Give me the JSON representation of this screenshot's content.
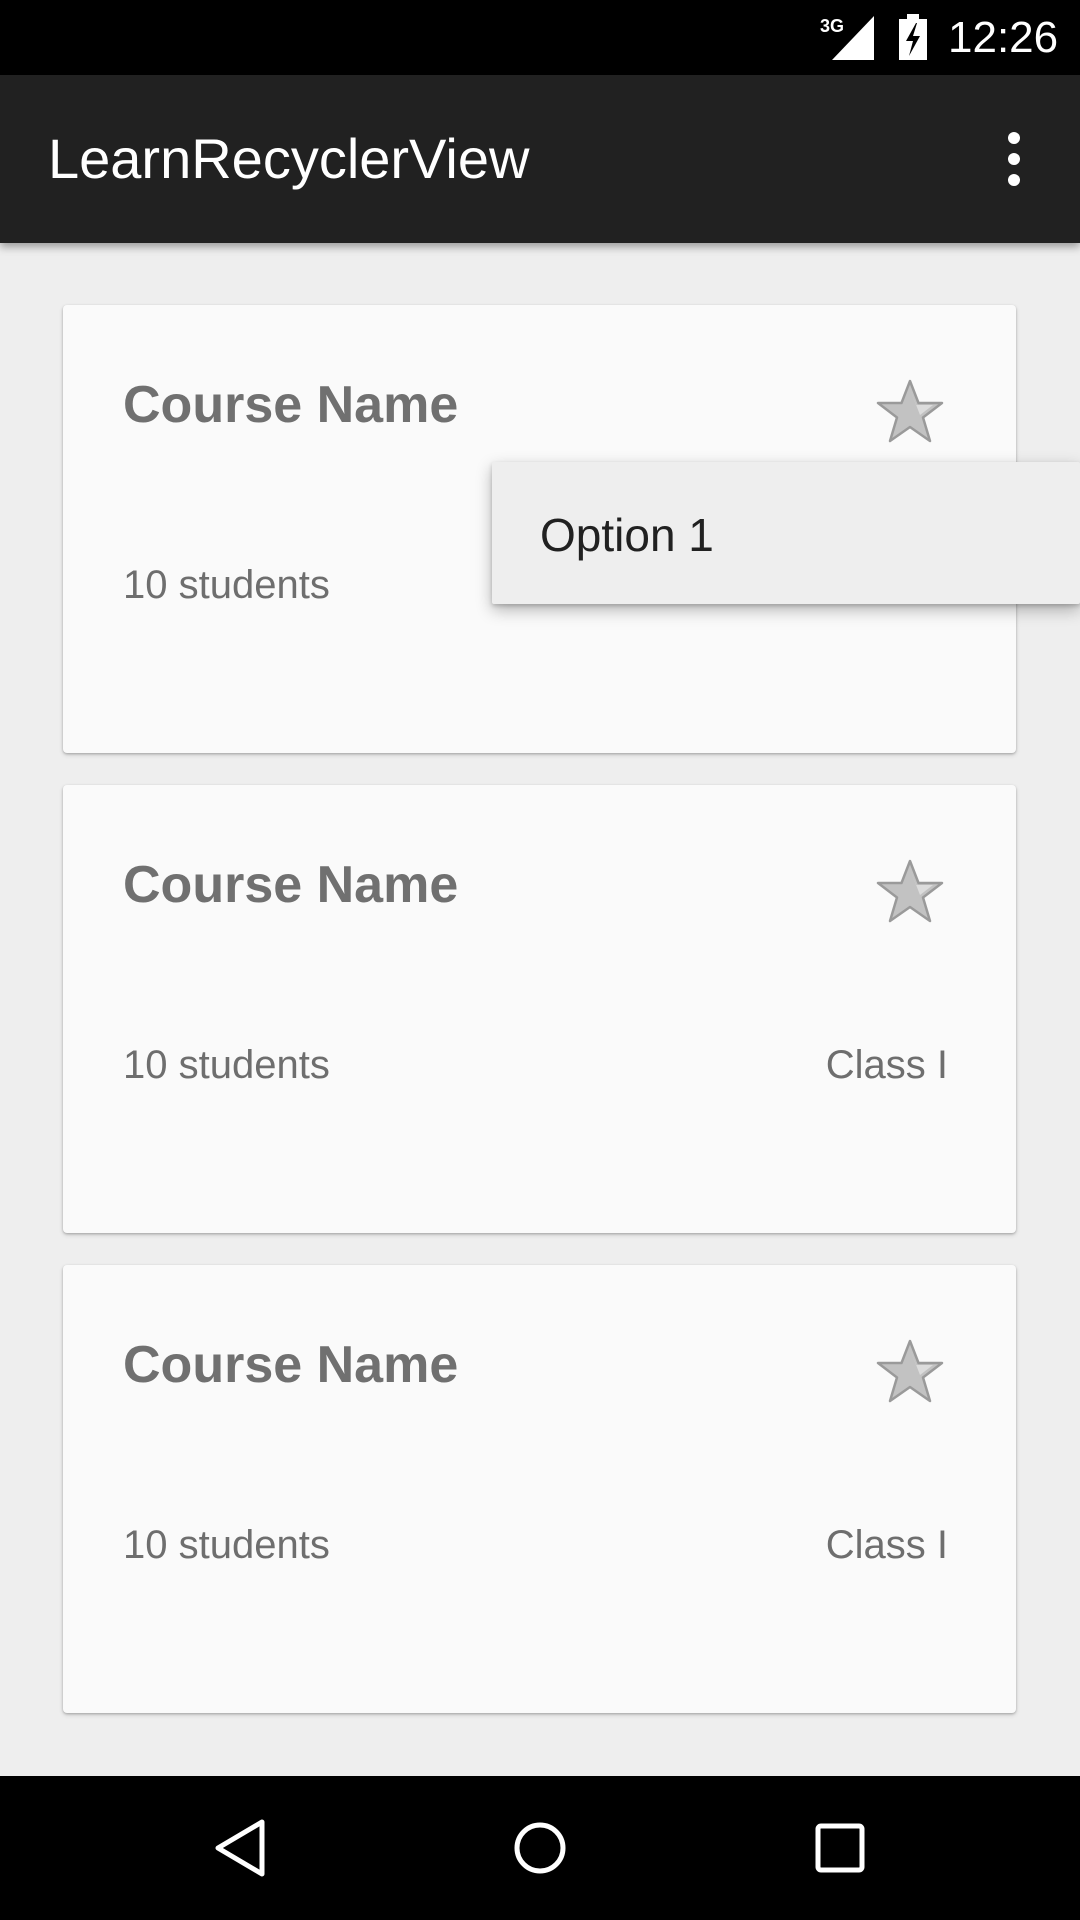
{
  "status_bar": {
    "network_type": "3G",
    "time": "12:26",
    "icons": [
      "signal-3g-icon",
      "battery-charging-icon"
    ]
  },
  "app_bar": {
    "title": "LearnRecyclerView",
    "overflow_icon": "more-vert-icon"
  },
  "popup_menu": {
    "items": [
      {
        "label": "Option 1"
      }
    ]
  },
  "courses": [
    {
      "name": "Course Name",
      "students": "10 students",
      "class": "",
      "star_icon": "star-icon"
    },
    {
      "name": "Course Name",
      "students": "10 students",
      "class": "Class I",
      "star_icon": "star-icon"
    },
    {
      "name": "Course Name",
      "students": "10 students",
      "class": "Class I",
      "star_icon": "star-icon"
    }
  ],
  "nav_bar": {
    "icons": [
      "back-icon",
      "home-icon",
      "recents-icon"
    ]
  },
  "colors": {
    "app_bar": "#212121",
    "background": "#eeeeee",
    "card": "#fafafa",
    "text_secondary": "#6e6e6e"
  }
}
